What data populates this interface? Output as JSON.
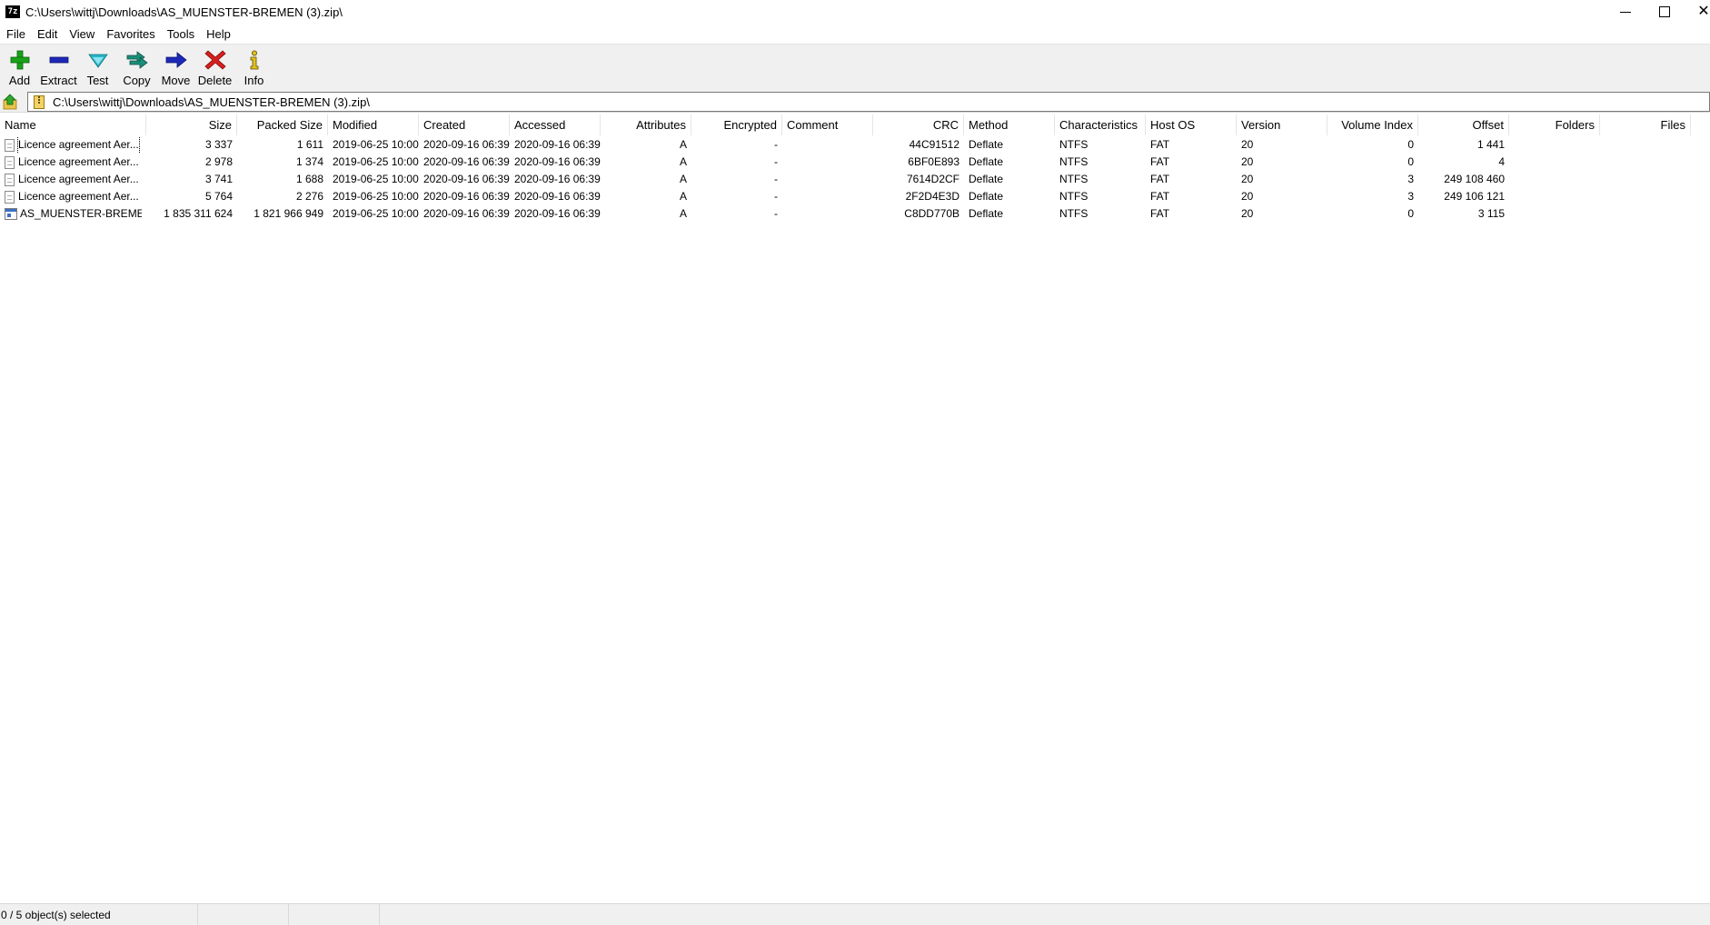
{
  "window": {
    "title": "C:\\Users\\wittj\\Downloads\\AS_MUENSTER-BREMEN (3).zip\\",
    "logo_text": "7z"
  },
  "menu": [
    "File",
    "Edit",
    "View",
    "Favorites",
    "Tools",
    "Help"
  ],
  "toolbar": {
    "buttons": [
      {
        "label": "Add",
        "icon": "plus-icon",
        "color": "#19a319"
      },
      {
        "label": "Extract",
        "icon": "minus-icon",
        "color": "#1d28b8"
      },
      {
        "label": "Test",
        "icon": "check-down-icon",
        "color": "#26b7c9"
      },
      {
        "label": "Copy",
        "icon": "copy-arrow-icon",
        "color": "#1a8f7a"
      },
      {
        "label": "Move",
        "icon": "move-arrow-icon",
        "color": "#1d28b8"
      },
      {
        "label": "Delete",
        "icon": "delete-x-icon",
        "color": "#d81e1e"
      },
      {
        "label": "Info",
        "icon": "info-icon",
        "color": "#e0c01e"
      }
    ]
  },
  "address": {
    "path": "C:\\Users\\wittj\\Downloads\\AS_MUENSTER-BREMEN (3).zip\\"
  },
  "columns": [
    "Name",
    "Size",
    "Packed Size",
    "Modified",
    "Created",
    "Accessed",
    "Attributes",
    "Encrypted",
    "Comment",
    "CRC",
    "Method",
    "Characteristics",
    "Host OS",
    "Version",
    "Volume Index",
    "Offset",
    "Folders",
    "Files"
  ],
  "rows": [
    {
      "name": "Licence agreement Aer...",
      "size": "3 337",
      "packed": "1 611",
      "modified": "2019-06-25 10:00",
      "created": "2020-09-16 06:39",
      "accessed": "2020-09-16 06:39",
      "attributes": "A",
      "encrypted": "-",
      "comment": "",
      "crc": "44C91512",
      "method": "Deflate",
      "characteristics": "NTFS",
      "host_os": "FAT",
      "version": "20",
      "volume_index": "0",
      "offset": "1 441",
      "icon": "text-file-icon"
    },
    {
      "name": "Licence agreement Aer...",
      "size": "2 978",
      "packed": "1 374",
      "modified": "2019-06-25 10:00",
      "created": "2020-09-16 06:39",
      "accessed": "2020-09-16 06:39",
      "attributes": "A",
      "encrypted": "-",
      "comment": "",
      "crc": "6BF0E893",
      "method": "Deflate",
      "characteristics": "NTFS",
      "host_os": "FAT",
      "version": "20",
      "volume_index": "0",
      "offset": "4",
      "icon": "text-file-icon"
    },
    {
      "name": "Licence agreement Aer...",
      "size": "3 741",
      "packed": "1 688",
      "modified": "2019-06-25 10:00",
      "created": "2020-09-16 06:39",
      "accessed": "2020-09-16 06:39",
      "attributes": "A",
      "encrypted": "-",
      "comment": "",
      "crc": "7614D2CF",
      "method": "Deflate",
      "characteristics": "NTFS",
      "host_os": "FAT",
      "version": "20",
      "volume_index": "3",
      "offset": "249 108 460",
      "icon": "text-file-icon"
    },
    {
      "name": "Licence agreement Aer...",
      "size": "5 764",
      "packed": "2 276",
      "modified": "2019-06-25 10:00",
      "created": "2020-09-16 06:39",
      "accessed": "2020-09-16 06:39",
      "attributes": "A",
      "encrypted": "-",
      "comment": "",
      "crc": "2F2D4E3D",
      "method": "Deflate",
      "characteristics": "NTFS",
      "host_os": "FAT",
      "version": "20",
      "volume_index": "3",
      "offset": "249 106 121",
      "icon": "text-file-icon"
    },
    {
      "name": "AS_MUENSTER-BREME...",
      "size": "1 835 311 624",
      "packed": "1 821 966 949",
      "modified": "2019-06-25 10:00",
      "created": "2020-09-16 06:39",
      "accessed": "2020-09-16 06:39",
      "attributes": "A",
      "encrypted": "-",
      "comment": "",
      "crc": "C8DD770B",
      "method": "Deflate",
      "characteristics": "NTFS",
      "host_os": "FAT",
      "version": "20",
      "volume_index": "0",
      "offset": "3 115",
      "icon": "app-file-icon"
    }
  ],
  "status": {
    "selected": "0 / 5 object(s) selected",
    "seg2": "",
    "seg3": "",
    "seg4": ""
  }
}
